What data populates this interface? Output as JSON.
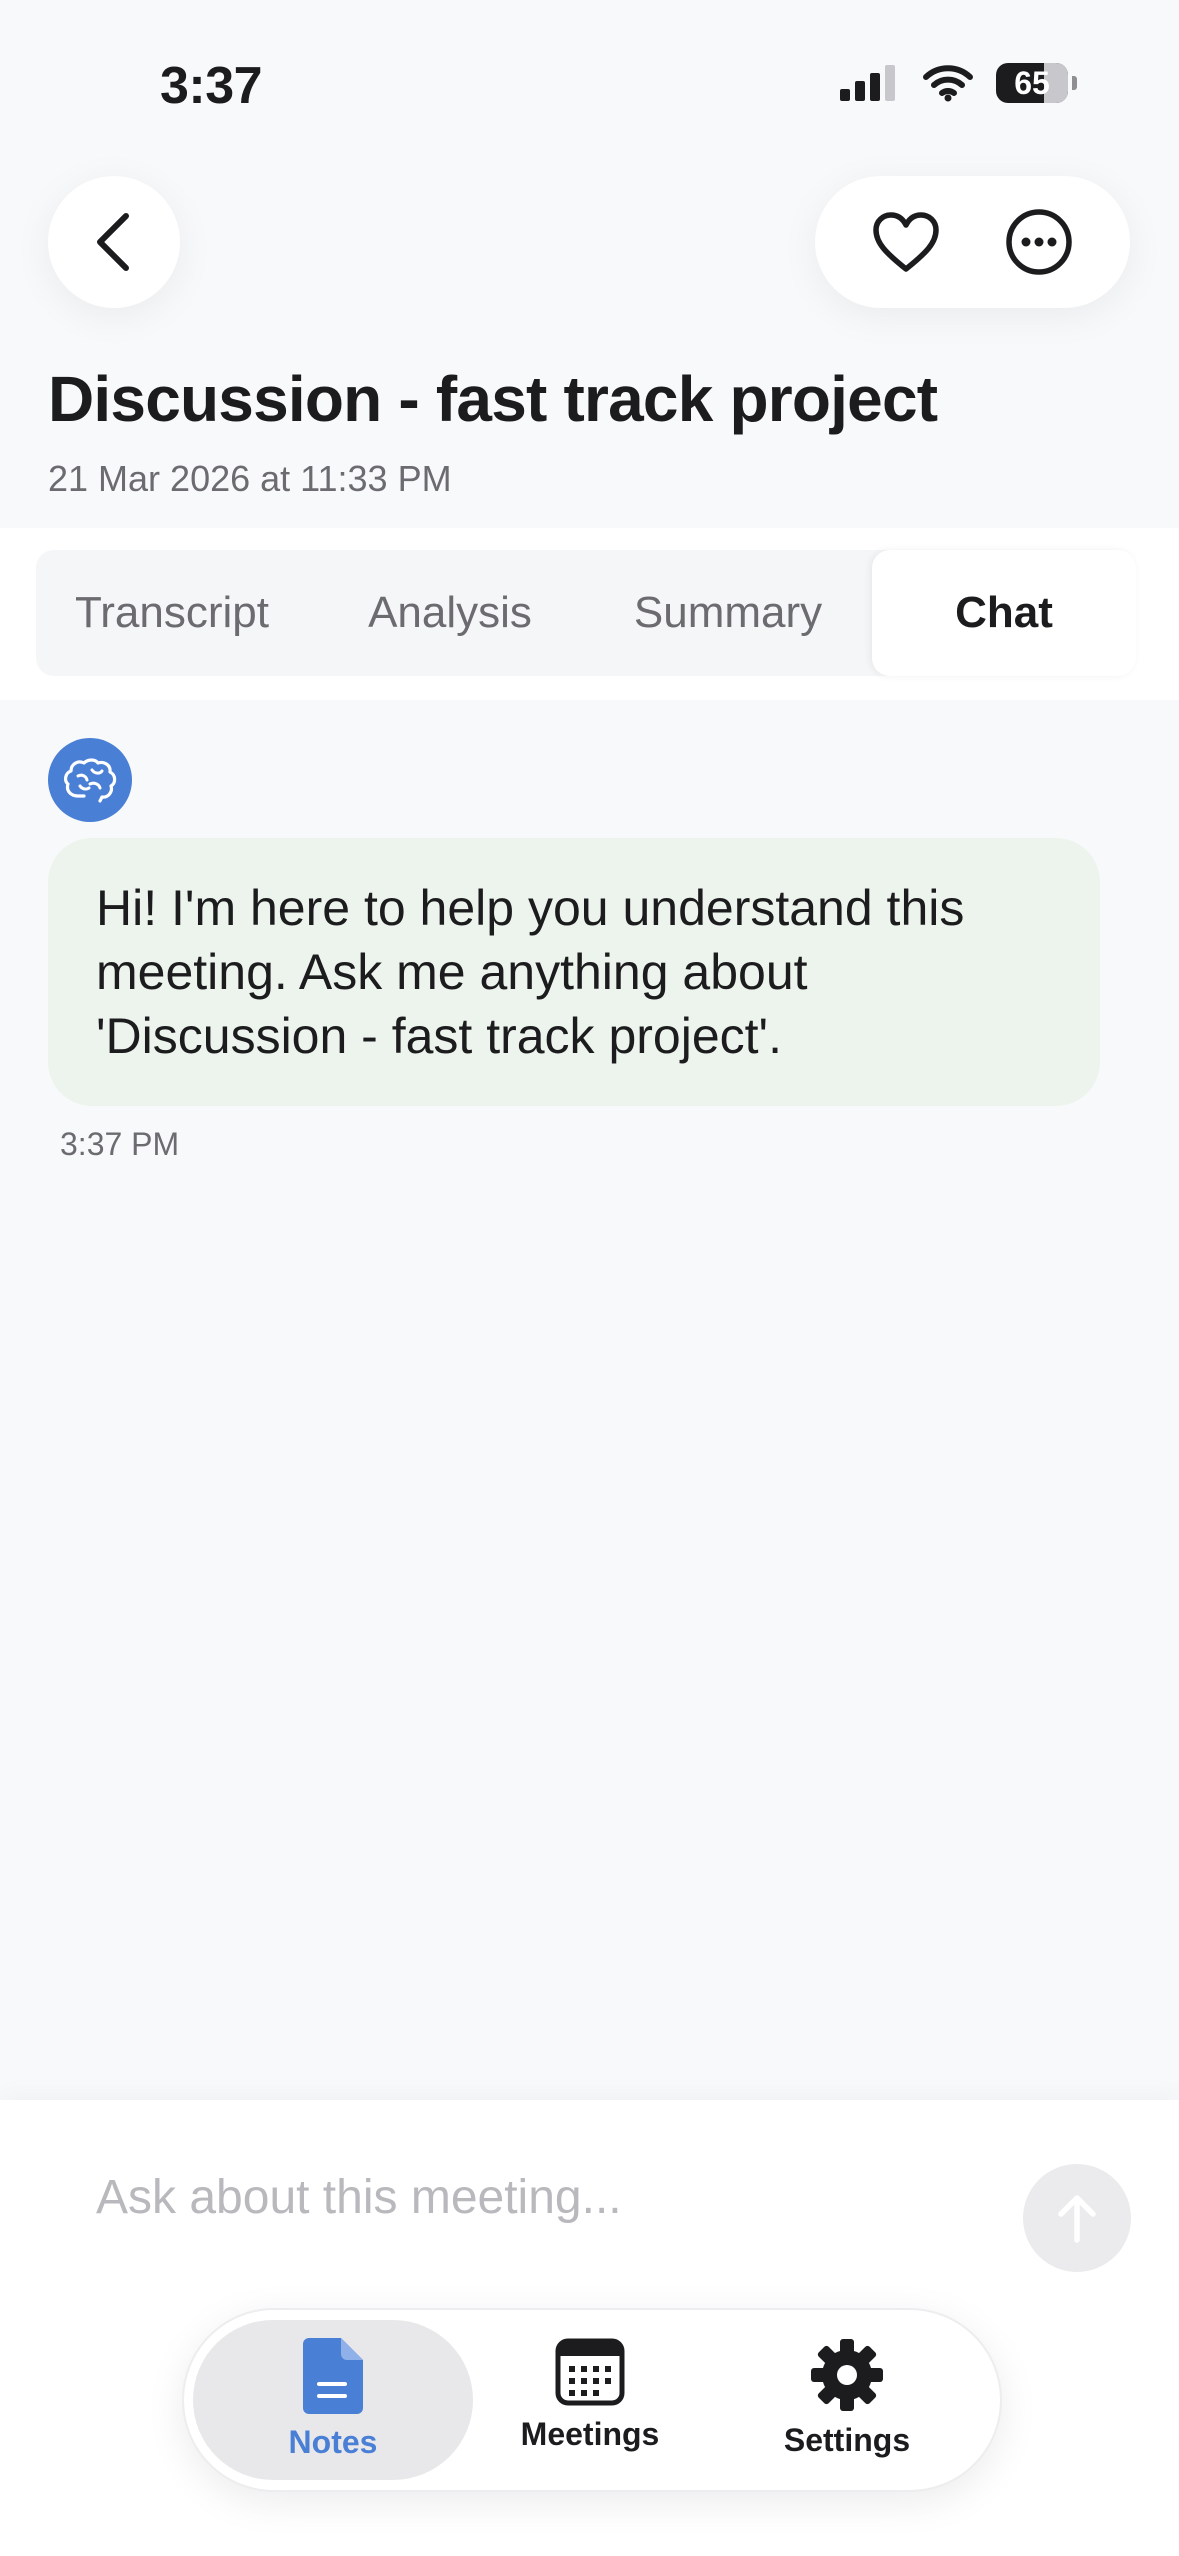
{
  "status_bar": {
    "time": "3:37",
    "battery": "65"
  },
  "header": {
    "title": "Discussion - fast track project",
    "subtitle": "21 Mar 2026 at 11:33 PM"
  },
  "tabs": {
    "items": [
      {
        "label": "Transcript"
      },
      {
        "label": "Analysis"
      },
      {
        "label": "Summary"
      },
      {
        "label": "Chat"
      }
    ],
    "active": "Chat"
  },
  "chat": {
    "messages": [
      {
        "text": "Hi! I'm here to help you understand this meeting. Ask me anything about 'Discussion - fast track project'.",
        "time": "3:37 PM"
      }
    ]
  },
  "input": {
    "placeholder": "Ask about this meeting..."
  },
  "nav": {
    "items": [
      {
        "label": "Notes",
        "icon": "document-icon"
      },
      {
        "label": "Meetings",
        "icon": "calendar-icon"
      },
      {
        "label": "Settings",
        "icon": "gear-icon"
      }
    ],
    "active": "Notes"
  },
  "colors": {
    "accent": "#4a7fd6",
    "bubble": "#edf4ed",
    "background": "#f8f9fb"
  }
}
